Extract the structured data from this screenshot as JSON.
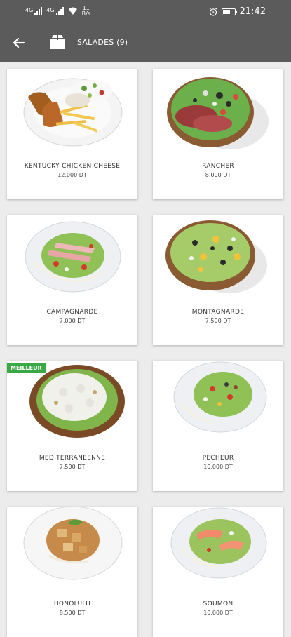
{
  "status": {
    "signal1": "4G",
    "signal2": "4G",
    "netspeed_top": "11",
    "netspeed_bottom": "B/s",
    "time": "21:42",
    "battery_level": 0.65
  },
  "appbar": {
    "title": "SALADES (9)"
  },
  "products": [
    {
      "name": "KENTUCKY CHICKEN CHEESE",
      "price": "12,000 DT",
      "badge": ""
    },
    {
      "name": "RANCHER",
      "price": "8,000 DT",
      "badge": ""
    },
    {
      "name": "CAMPAGNARDE",
      "price": "7,000 DT",
      "badge": ""
    },
    {
      "name": "MONTAGNARDE",
      "price": "7,500 DT",
      "badge": ""
    },
    {
      "name": "MEDITERRANEENNE",
      "price": "7,500 DT",
      "badge": "MEILLEUR"
    },
    {
      "name": "PECHEUR",
      "price": "10,000 DT",
      "badge": ""
    },
    {
      "name": "HONOLULU",
      "price": "8,500 DT",
      "badge": ""
    },
    {
      "name": "SOUMON",
      "price": "10,000 DT",
      "badge": ""
    }
  ]
}
